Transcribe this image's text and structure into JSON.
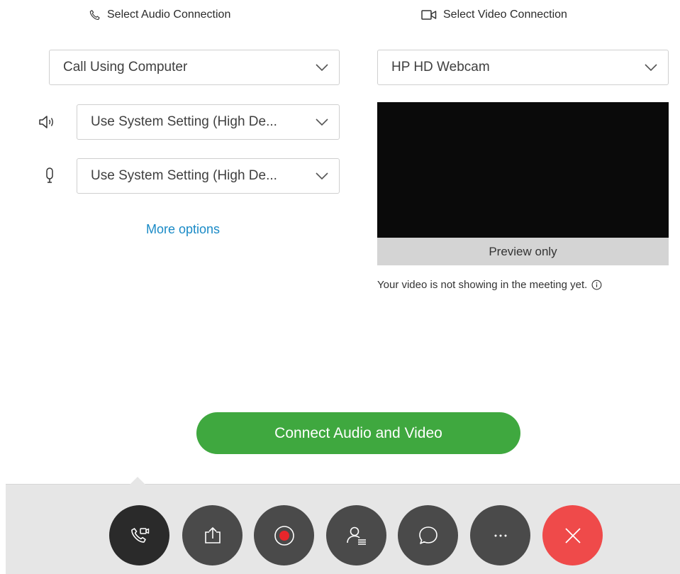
{
  "audio": {
    "header": "Select Audio Connection",
    "connection_value": "Call Using Computer",
    "speaker_value": "Use System Setting (High De...",
    "microphone_value": "Use System Setting (High De...",
    "more_options_label": "More options"
  },
  "video": {
    "header": "Select Video Connection",
    "camera_value": "HP HD Webcam",
    "preview_label": "Preview only",
    "note": "Your video is not showing in the meeting yet."
  },
  "connect_button_label": "Connect Audio and Video",
  "controls": [
    {
      "name": "audio-video-button",
      "icon": "phone-video-icon"
    },
    {
      "name": "share-button",
      "icon": "share-upload-icon"
    },
    {
      "name": "record-button",
      "icon": "record-icon"
    },
    {
      "name": "participants-button",
      "icon": "participants-icon"
    },
    {
      "name": "chat-button",
      "icon": "chat-icon"
    },
    {
      "name": "more-button",
      "icon": "more-icon"
    },
    {
      "name": "leave-button",
      "icon": "close-icon"
    }
  ],
  "colors": {
    "link": "#1a8ac6",
    "connect_green": "#3fa83f",
    "leave_red": "#ef4a4a",
    "record_red": "#e8262b",
    "control_dark": "#4a4a4a"
  }
}
